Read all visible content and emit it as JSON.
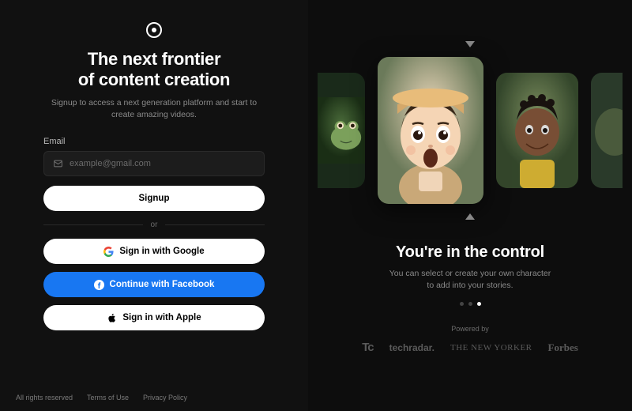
{
  "left": {
    "headline_line1": "The next frontier",
    "headline_line2": "of content creation",
    "subtitle": "Signup to access a next generation platform and start to create amazing videos.",
    "email_label": "Email",
    "email_placeholder": "example@gmail.com",
    "signup_label": "Signup",
    "divider_label": "or",
    "google_label": "Sign in with Google",
    "facebook_label": "Continue with Facebook",
    "apple_label": "Sign in with Apple"
  },
  "footer": {
    "rights": "All rights reserved",
    "terms": "Terms of Use",
    "privacy": "Privacy Policy"
  },
  "right": {
    "title": "You're in the control",
    "desc": "You can select or create your own character to add into your stories.",
    "powered_label": "Powered by",
    "brands": {
      "tc": "Tc",
      "techradar": "techradar.",
      "newyorker": "THE NEW YORKER",
      "forbes": "Forbes"
    },
    "carousel_characters": [
      "frog",
      "surprised-girl",
      "happy-boy"
    ],
    "active_dot_index": 2,
    "dot_count": 3
  }
}
